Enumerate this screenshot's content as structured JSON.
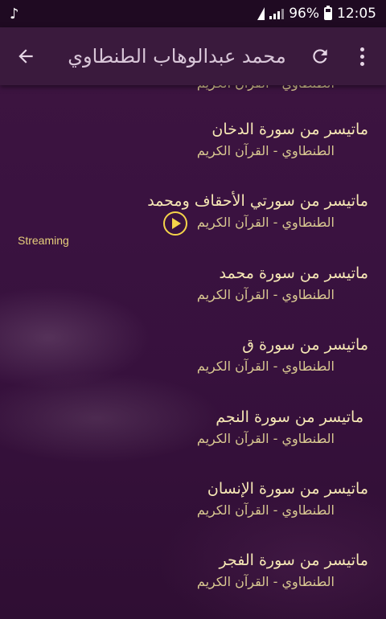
{
  "status_bar": {
    "music_icon": "music-note-icon",
    "battery_percent": "96%",
    "time": "12:05"
  },
  "toolbar": {
    "title": "محمد عبدالوهاب الطنطاوي",
    "back_icon": "back-arrow-icon",
    "refresh_icon": "refresh-icon",
    "menu_icon": "more-vert-icon"
  },
  "list": {
    "partial_subtitle": "الطنطاوي - القرآن الكريم",
    "items": [
      {
        "title": "ماتيسر من سورة الدخان",
        "subtitle": "الطنطاوي - القرآن الكريم"
      },
      {
        "title": "ماتيسر من سورتي الأحقاف ومحمد",
        "subtitle": "الطنطاوي - القرآن الكريم",
        "status": "Streaming"
      },
      {
        "title": "ماتيسر من سورة محمد",
        "subtitle": "الطنطاوي - القرآن الكريم"
      },
      {
        "title": "ماتيسر من سورة ق",
        "subtitle": "الطنطاوي - القرآن الكريم"
      },
      {
        "title": "ماتيسر من سورة النجم",
        "subtitle": "الطنطاوي - القرآن الكريم"
      },
      {
        "title": "ماتيسر من سورة الإنسان",
        "subtitle": "الطنطاوي - القرآن الكريم"
      },
      {
        "title": "ماتيسر من سورة الفجر",
        "subtitle": "الطنطاوي - القرآن الكريم"
      }
    ]
  },
  "colors": {
    "title_text": "#f6e7b5",
    "subtitle_text": "#d9c891",
    "accent": "#f5d44a",
    "toolbar": "#3a1a3d"
  }
}
